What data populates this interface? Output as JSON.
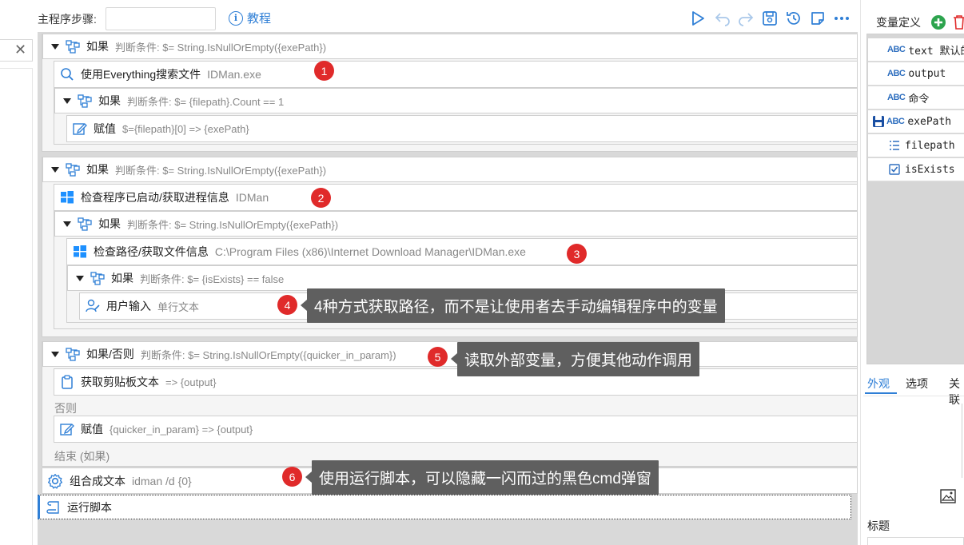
{
  "toolbar": {
    "steps_label": "主程序步骤:",
    "steps_value": "",
    "tutorial_label": "教程",
    "icons": [
      "play-icon",
      "undo-icon",
      "redo-icon",
      "save-icon",
      "history-icon",
      "note-icon",
      "more-icon"
    ]
  },
  "steps": [
    {
      "title": "如果",
      "detail": "判断条件:  $= String.IsNullOrEmpty({exePath})"
    },
    {
      "title": "使用Everything搜索文件",
      "detail": "IDMan.exe"
    },
    {
      "title": "如果",
      "detail": "判断条件:  $= {filepath}.Count == 1"
    },
    {
      "title": "赋值",
      "detail": "$={filepath}[0] => {exePath}"
    },
    {
      "title": "如果",
      "detail": "判断条件:  $= String.IsNullOrEmpty({exePath})"
    },
    {
      "title": "检查程序已启动/获取进程信息",
      "detail": "IDMan"
    },
    {
      "title": "如果",
      "detail": "判断条件:  $= String.IsNullOrEmpty({exePath})"
    },
    {
      "title": "检查路径/获取文件信息",
      "detail": "C:\\Program Files (x86)\\Internet Download Manager\\IDMan.exe"
    },
    {
      "title": "如果",
      "detail": "判断条件:  $= {isExists} == false"
    },
    {
      "title": "用户输入",
      "detail": "单行文本"
    },
    {
      "title": "如果/否则",
      "detail": "判断条件:  $= String.IsNullOrEmpty({quicker_in_param})"
    },
    {
      "title": "获取剪贴板文本",
      "detail": "=> {output}"
    },
    {
      "title": "否则",
      "detail": ""
    },
    {
      "title": "赋值",
      "detail": "{quicker_in_param} => {output}"
    },
    {
      "title": "结束 (如果)",
      "detail": ""
    },
    {
      "title": "组合成文本",
      "detail": "idman /d {0}"
    },
    {
      "title": "运行脚本",
      "detail": ""
    }
  ],
  "badges": [
    "1",
    "2",
    "3",
    "4",
    "5",
    "6"
  ],
  "callouts": [
    "4种方式获取路径，而不是让使用者去手动编辑程序中的变量",
    "读取外部变量，方便其他动作调用",
    "使用运行脚本，可以隐藏一闪而过的黑色cmd弹窗"
  ],
  "variables": {
    "title": "变量定义",
    "items": [
      {
        "type": "ABC",
        "name": "text 默认的"
      },
      {
        "type": "ABC",
        "name": "output"
      },
      {
        "type": "ABC",
        "name": "命令"
      },
      {
        "type": "ABC",
        "name": "exePath"
      },
      {
        "type": "list",
        "name": "filepath"
      },
      {
        "type": "bool",
        "name": "isExists"
      }
    ]
  },
  "bottom_tabs": [
    "外观",
    "选项",
    "关联"
  ],
  "field_label": "标题",
  "colors": {
    "accent": "#2f7fd6",
    "badge": "#e02a2a",
    "callout": "#5f5f5f",
    "add": "#2da44e",
    "delete": "#e02a2a"
  }
}
